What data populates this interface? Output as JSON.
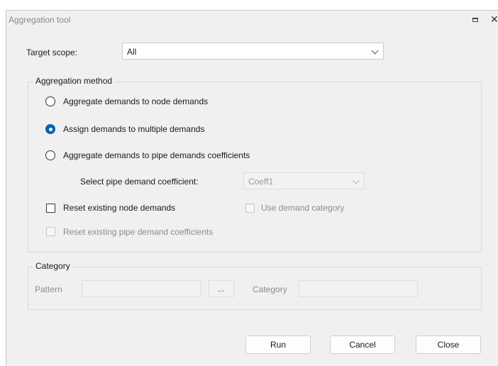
{
  "window": {
    "title": "Aggregation tool"
  },
  "target_scope": {
    "label": "Target scope:",
    "value": "All"
  },
  "method": {
    "title": "Aggregation method",
    "options": [
      {
        "label": "Aggregate demands to node demands",
        "checked": false
      },
      {
        "label": "Assign demands to multiple demands",
        "checked": true
      },
      {
        "label": "Aggregate demands to pipe demands coefficients",
        "checked": false
      }
    ],
    "coefficient_label": "Select pipe demand coefficient:",
    "coefficient_value": "Coeff1",
    "reset_node_label": "Reset existing node demands",
    "use_category_label": "Use demand category",
    "reset_pipe_label": "Reset existing pipe demand coefficients"
  },
  "category": {
    "title": "Category",
    "pattern_label": "Pattern",
    "browse_label": "...",
    "category_label": "Category"
  },
  "buttons": {
    "run": "Run",
    "cancel": "Cancel",
    "close": "Close"
  }
}
